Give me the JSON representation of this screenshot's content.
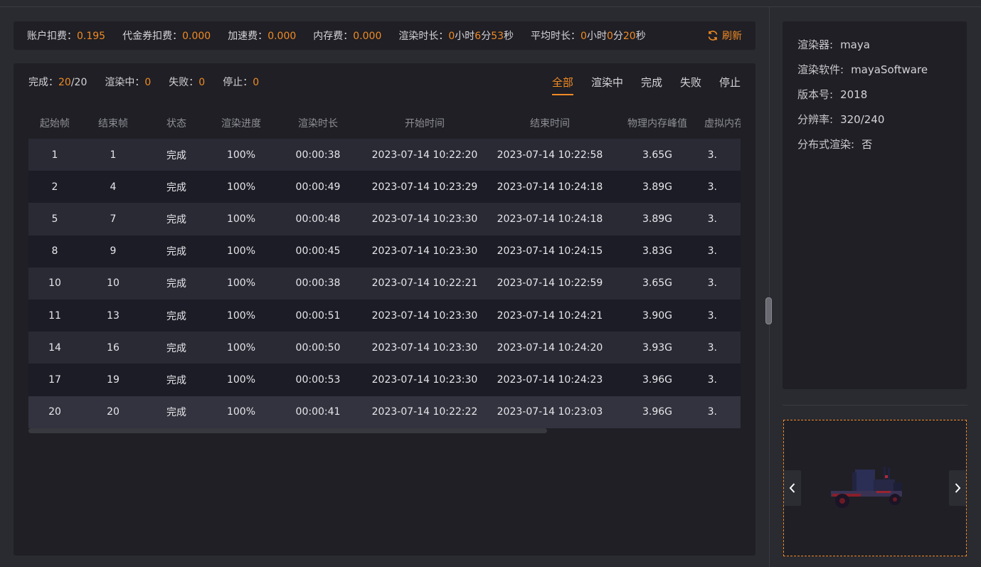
{
  "fees": {
    "account_label": "账户扣费：",
    "account_value": "0.195",
    "voucher_label": "代金券扣费：",
    "voucher_value": "0.000",
    "accel_label": "加速费：",
    "accel_value": "0.000",
    "memory_label": "内存费：",
    "memory_value": "0.000",
    "render_time_label": "渲染时长：",
    "render_time": {
      "h": "0",
      "h_unit": "小时",
      "m": "6",
      "m_unit": "分",
      "s": "53",
      "s_unit": "秒"
    },
    "avg_time_label": "平均时长：",
    "avg_time": {
      "h": "0",
      "h_unit": "小时",
      "m": "0",
      "m_unit": "分",
      "s": "20",
      "s_unit": "秒"
    },
    "refresh_label": "刷新"
  },
  "stats": {
    "done_label": "完成：",
    "done_value": "20",
    "done_total": "/20",
    "rendering_label": "渲染中：",
    "rendering_value": "0",
    "failed_label": "失败：",
    "failed_value": "0",
    "stopped_label": "停止：",
    "stopped_value": "0"
  },
  "tabs": [
    "全部",
    "渲染中",
    "完成",
    "失败",
    "停止"
  ],
  "table": {
    "headers": [
      "起始帧",
      "结束帧",
      "状态",
      "渲染进度",
      "渲染时长",
      "开始时间",
      "结束时间",
      "物理内存峰值",
      "虚拟内存峰值"
    ],
    "rows": [
      [
        "1",
        "1",
        "完成",
        "100%",
        "00:00:38",
        "2023-07-14 10:22:20",
        "2023-07-14 10:22:58",
        "3.65G",
        "3."
      ],
      [
        "2",
        "4",
        "完成",
        "100%",
        "00:00:49",
        "2023-07-14 10:23:29",
        "2023-07-14 10:24:18",
        "3.89G",
        "3."
      ],
      [
        "5",
        "7",
        "完成",
        "100%",
        "00:00:48",
        "2023-07-14 10:23:30",
        "2023-07-14 10:24:18",
        "3.89G",
        "3."
      ],
      [
        "8",
        "9",
        "完成",
        "100%",
        "00:00:45",
        "2023-07-14 10:23:30",
        "2023-07-14 10:24:15",
        "3.83G",
        "3."
      ],
      [
        "10",
        "10",
        "完成",
        "100%",
        "00:00:38",
        "2023-07-14 10:22:21",
        "2023-07-14 10:22:59",
        "3.65G",
        "3."
      ],
      [
        "11",
        "13",
        "完成",
        "100%",
        "00:00:51",
        "2023-07-14 10:23:30",
        "2023-07-14 10:24:21",
        "3.90G",
        "3."
      ],
      [
        "14",
        "16",
        "完成",
        "100%",
        "00:00:50",
        "2023-07-14 10:23:30",
        "2023-07-14 10:24:20",
        "3.93G",
        "3."
      ],
      [
        "17",
        "19",
        "完成",
        "100%",
        "00:00:53",
        "2023-07-14 10:23:30",
        "2023-07-14 10:24:23",
        "3.96G",
        "3."
      ],
      [
        "20",
        "20",
        "完成",
        "100%",
        "00:00:41",
        "2023-07-14 10:22:22",
        "2023-07-14 10:23:03",
        "3.96G",
        "3."
      ]
    ]
  },
  "info": {
    "renderer_label": "渲染器:",
    "renderer": "maya",
    "software_label": "渲染软件:",
    "software": "mayaSoftware",
    "version_label": "版本号:",
    "version": "2018",
    "resolution_label": "分辨率:",
    "resolution": "320/240",
    "distributed_label": "分布式渲染:",
    "distributed": "否"
  },
  "colors": {
    "accent": "#f08a24",
    "panel": "#1f1f25",
    "background": "#2a2a31"
  }
}
